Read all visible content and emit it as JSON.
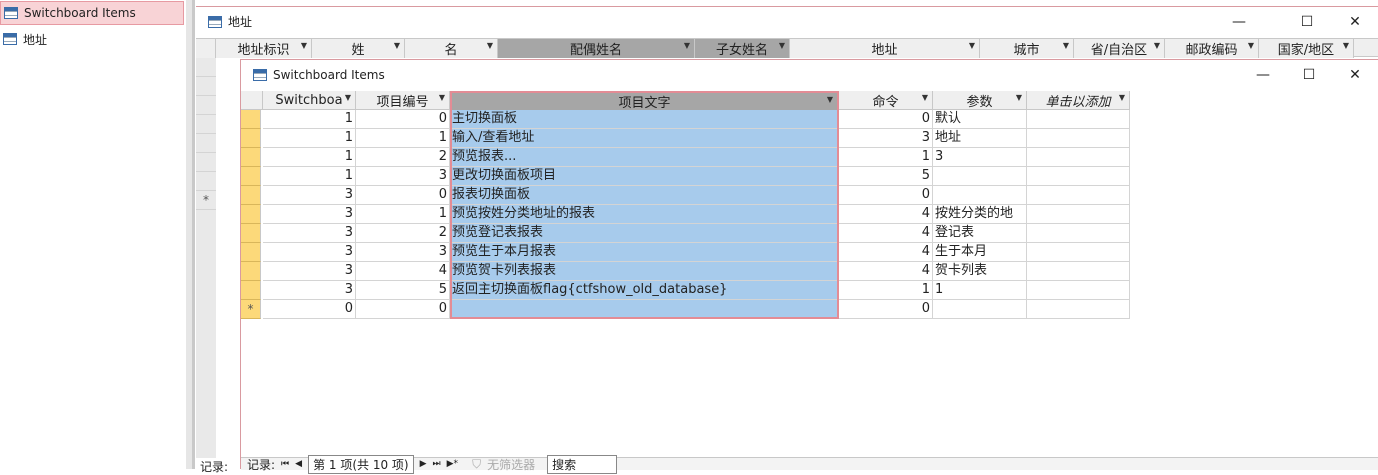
{
  "nav": {
    "items": [
      {
        "label": "Switchboard Items",
        "icon": "table-icon",
        "selected": true
      },
      {
        "label": "地址",
        "icon": "table-icon",
        "selected": false
      }
    ]
  },
  "outer_window": {
    "title": "地址",
    "columns": [
      "地址标识",
      "姓",
      "名",
      "配偶姓名",
      "子女姓名",
      "地址",
      "城市",
      "省/自治区",
      "邮政编码",
      "国家/地区"
    ],
    "status_label": "记录:"
  },
  "inner_window": {
    "title": "Switchboard Items",
    "columns": [
      "Switchboa",
      "项目编号",
      "项目文字",
      "命令",
      "参数",
      "单击以添加"
    ],
    "rows": [
      {
        "marker": "",
        "switchboard_id": "1",
        "item_number": "0",
        "item_text": "主切换面板",
        "command": "0",
        "argument": "默认"
      },
      {
        "marker": "",
        "switchboard_id": "1",
        "item_number": "1",
        "item_text": "输入/查看地址",
        "command": "3",
        "argument": "地址"
      },
      {
        "marker": "",
        "switchboard_id": "1",
        "item_number": "2",
        "item_text": "预览报表...",
        "command": "1",
        "argument": "3"
      },
      {
        "marker": "",
        "switchboard_id": "1",
        "item_number": "3",
        "item_text": "更改切换面板项目",
        "command": "5",
        "argument": ""
      },
      {
        "marker": "",
        "switchboard_id": "3",
        "item_number": "0",
        "item_text": "报表切换面板",
        "command": "0",
        "argument": ""
      },
      {
        "marker": "",
        "switchboard_id": "3",
        "item_number": "1",
        "item_text": "预览按姓分类地址的报表",
        "command": "4",
        "argument": "按姓分类的地"
      },
      {
        "marker": "",
        "switchboard_id": "3",
        "item_number": "2",
        "item_text": "预览登记表报表",
        "command": "4",
        "argument": "登记表"
      },
      {
        "marker": "",
        "switchboard_id": "3",
        "item_number": "3",
        "item_text": "预览生于本月报表",
        "command": "4",
        "argument": "生于本月"
      },
      {
        "marker": "",
        "switchboard_id": "3",
        "item_number": "4",
        "item_text": "预览贺卡列表报表",
        "command": "4",
        "argument": "贺卡列表"
      },
      {
        "marker": "",
        "switchboard_id": "3",
        "item_number": "5",
        "item_text": "返回主切换面板flag{ctfshow_old_database}",
        "command": "1",
        "argument": "1"
      },
      {
        "marker": "*",
        "switchboard_id": "0",
        "item_number": "0",
        "item_text": "",
        "command": "0",
        "argument": ""
      }
    ],
    "status": {
      "label": "记录:",
      "first": "⏮",
      "prev": "◀",
      "position": "第 1 项(共 10 项)",
      "next": "▶",
      "last": "⏭",
      "new": "▶*",
      "filter": "无筛选器",
      "search": "搜索"
    }
  },
  "outer_row_marker": "*",
  "colors": {
    "selected_column": "#a7cbec",
    "row_selector": "#fcd97a",
    "nav_selected": "#f8d3d6",
    "window_border": "#d99aa0"
  }
}
